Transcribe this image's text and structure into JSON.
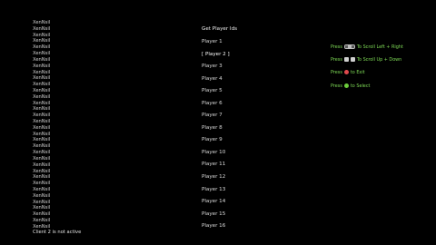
{
  "log": {
    "lines": [
      "XenNsil",
      "XenNsil",
      "XenNsil",
      "XenNsil",
      "XenNsil",
      "XenNsil",
      "XenNsil",
      "XenNsil",
      "XenNsil",
      "XenNsil",
      "XenNsil",
      "XenNsil",
      "XenNsil",
      "XenNsil",
      "XenNsil",
      "XenNsil",
      "XenNsil",
      "XenNsil",
      "XenNsil",
      "XenNsil",
      "XenNsil",
      "XenNsil",
      "XenNsil",
      "XenNsil",
      "XenNsil",
      "XenNsil",
      "XenNsil",
      "XenNsil",
      "XenNsil",
      "XenNsil",
      "XenNsil",
      "XenNsil",
      "XenNsil",
      "XenNsil"
    ],
    "status": "Client 2 is not active"
  },
  "player_list": {
    "title": "Get Player Ids",
    "players": [
      "Player 1",
      "[ Player 2 ]",
      "Player 3",
      "Player 4",
      "Player 5",
      "Player 6",
      "Player 7",
      "Player 8",
      "Player 9",
      "Player 10",
      "Player 11",
      "Player 12",
      "Player 13",
      "Player 14",
      "Player 15",
      "Player 16"
    ],
    "selected_index": 1
  },
  "help": {
    "rows": [
      {
        "prefix": "Press",
        "icon": "dpad-left-right-icon",
        "text": "To Scroll Left + Right"
      },
      {
        "prefix": "Press",
        "icon": "dpad-up-down-icon",
        "text": "To Scroll Up + Down"
      },
      {
        "prefix": "Press",
        "icon": "b-button-icon",
        "text": "to Exit"
      },
      {
        "prefix": "Press",
        "icon": "a-button-icon",
        "text": "to Select"
      }
    ]
  }
}
